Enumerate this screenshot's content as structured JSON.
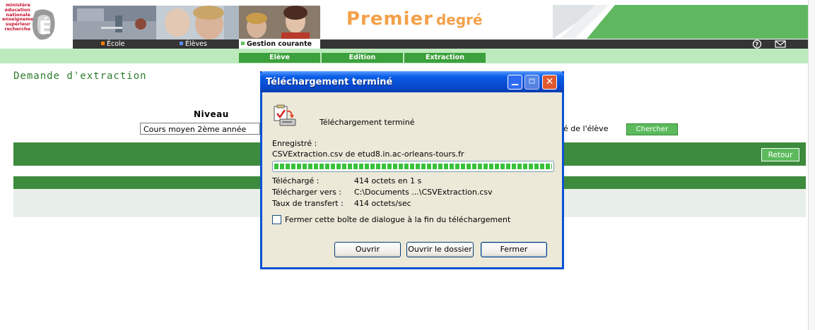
{
  "header": {
    "ministry_text": [
      "ministère",
      "éducation",
      "nationale",
      "enseignement",
      "supérieur",
      "recherche"
    ],
    "logo_letter": "É",
    "banner_title_main": "Premier",
    "banner_title_sub": "degré",
    "nav_tabs": [
      {
        "label": "École",
        "color": "#ff7f00"
      },
      {
        "label": "Élèves",
        "color": "#5b8cff"
      },
      {
        "label": "Gestion courante",
        "color": "#64c164"
      }
    ],
    "icons": {
      "help": "?",
      "mail": "✉"
    },
    "sub_tabs": [
      "Elève",
      "Edition",
      "Extraction"
    ]
  },
  "page": {
    "title": "Demande d'extraction",
    "niveau_label": "Niveau",
    "niveau_value": "Cours moyen 2ème année",
    "eleve_label_partial": "é de l'élève",
    "chercher": "Chercher",
    "retour": "Retour"
  },
  "dialog": {
    "title": "Téléchargement terminé",
    "heading": "Téléchargement terminé",
    "saved_label": "Enregistré :",
    "saved_file": "CSVExtraction.csv de etud8.in.ac-orleans-tours.fr",
    "progress_percent": 100,
    "info": [
      {
        "label": "Téléchargé :",
        "value": "414 octets en 1 s"
      },
      {
        "label": "Télécharger vers :",
        "value": "C:\\Documents ...\\CSVExtraction.csv"
      },
      {
        "label": "Taux de transfert :",
        "value": "414 octets/sec"
      }
    ],
    "close_on_finish_label": "Fermer cette boîte de dialogue à la fin du téléchargement",
    "close_on_finish_checked": false,
    "buttons": {
      "ouvrir": "Ouvrir",
      "ouvrir_dossier": "Ouvrir le dossier",
      "fermer": "Fermer"
    }
  },
  "colors": {
    "brand_green": "#3d8b3d",
    "title_orange": "#f4a04a",
    "dialog_blue": "#0a52d6"
  }
}
